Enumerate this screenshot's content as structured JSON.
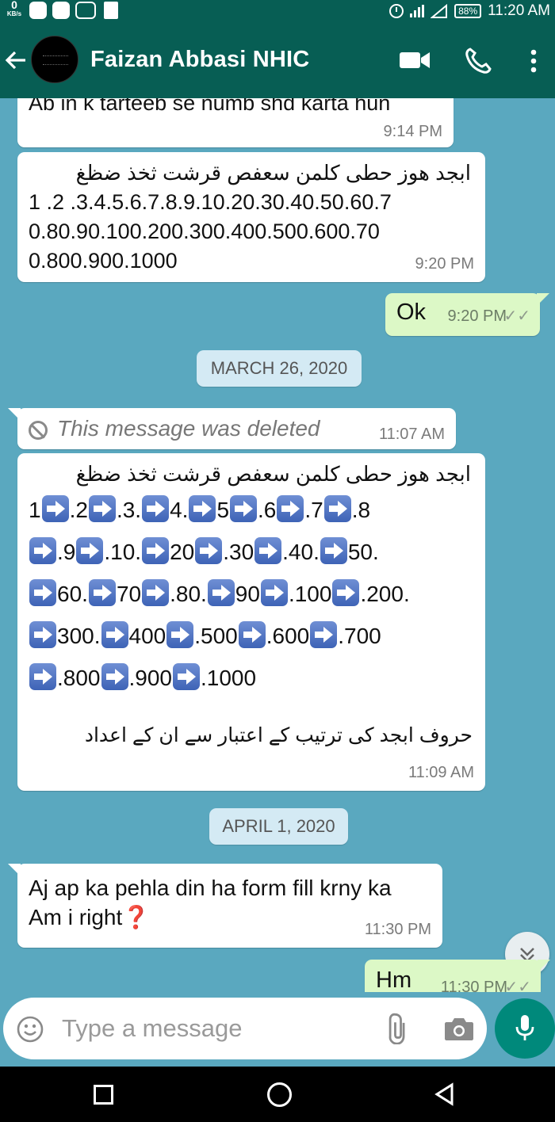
{
  "status_bar": {
    "net_speed": "0",
    "net_unit": "KB/s",
    "battery": "88%",
    "time": "11:20 AM"
  },
  "header": {
    "contact_name": "Faizan Abbasi NHIC"
  },
  "messages": [
    {
      "text": "Ab in k tarteeb se numb shd karta hun",
      "time": "9:14 PM"
    },
    {
      "line1": "ابجد ھوز حطی کلمن سعفص قرشت ثخذ ضظغ",
      "line2": "1 .2 .3.4.5.6.7.8.9.10.20.30.40.50.60.7",
      "line3": "0.80.90.100.200.300.400.500.600.70",
      "line4": "0.800.900.1000",
      "time": "9:20 PM"
    },
    {
      "text": "Ok",
      "time": "9:20 PM"
    },
    {
      "deleted_text": "This message was deleted",
      "time": "11:07 AM"
    },
    {
      "line1": "ابجد ھوز حطی کلمن سعفص قرشت ثخذ ضظغ",
      "row1": [
        "1",
        ".2",
        ".3.",
        "4.",
        "5",
        ".6",
        ".7",
        ".8"
      ],
      "row2": [
        "",
        ".9",
        ".10.",
        "20",
        ".30",
        ".40.",
        "50."
      ],
      "row3": [
        "",
        "60.",
        "70",
        ".80.",
        "90",
        ".100",
        ".200."
      ],
      "row4": [
        "",
        "300.",
        "400",
        ".500",
        ".600",
        ".700"
      ],
      "row5": [
        "",
        ".800",
        ".900",
        ".1000"
      ],
      "caption": "حروف ابجد کی ترتیب کے اعتبار سے ان کے اعداد",
      "time": "11:09 AM"
    },
    {
      "line1": "Aj ap ka pehla din ha form fill krny ka",
      "line2": "Am i right",
      "emoji": "❓",
      "time": "11:30 PM"
    },
    {
      "text": "Hm",
      "time": "11:30 PM"
    }
  ],
  "dates": {
    "march": "MARCH 26, 2020",
    "april": "APRIL 1, 2020"
  },
  "composer": {
    "placeholder": "Type a message"
  }
}
